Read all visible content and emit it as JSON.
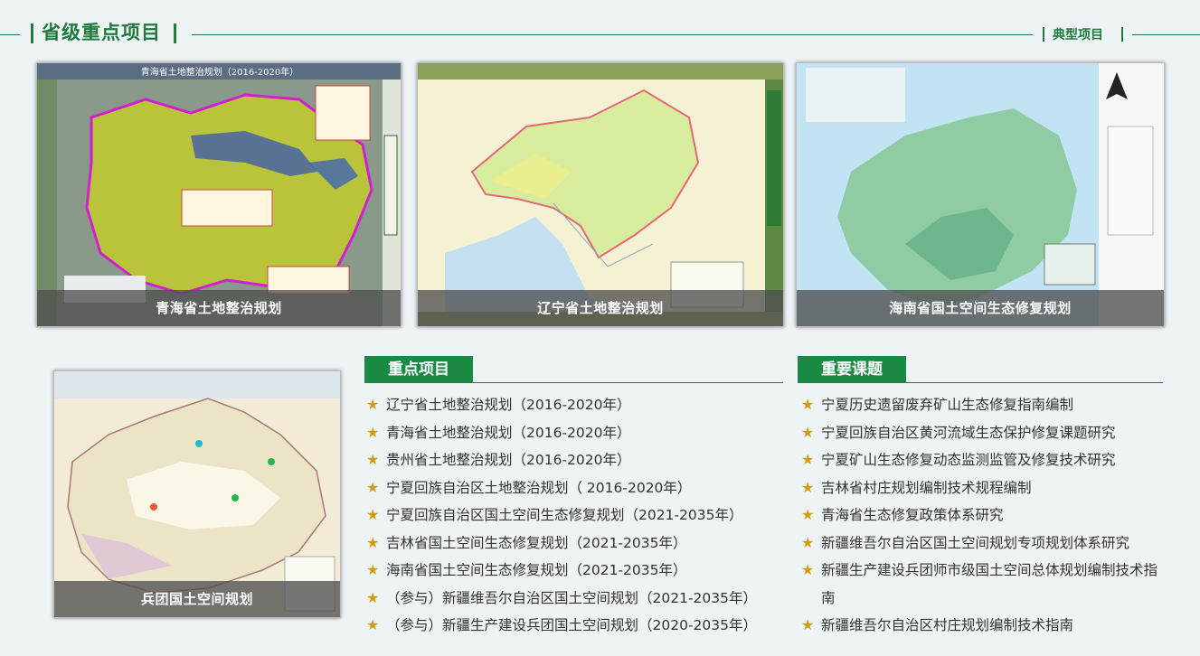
{
  "header": {
    "title": "省级重点项目",
    "more_label": "典型项目"
  },
  "cards": [
    {
      "caption": "青海省土地整治规划"
    },
    {
      "caption": "辽宁省土地整治规划"
    },
    {
      "caption": "海南省国土空间生态修复规划"
    },
    {
      "caption": "兵团国土空间规划"
    }
  ],
  "key_projects": {
    "title": "重点项目",
    "items": [
      "辽宁省土地整治规划（2016-2020年）",
      "青海省土地整治规划（2016-2020年）",
      "贵州省土地整治规划（2016-2020年）",
      "宁夏回族自治区土地整治规划（ 2016-2020年）",
      "宁夏回族自治区国土空间生态修复规划（2021-2035年）",
      "吉林省国土空间生态修复规划（2021-2035年）",
      "海南省国土空间生态修复规划（2021-2035年）",
      "（参与）新疆维吾尔自治区国土空间规划（2021-2035年）",
      "（参与）新疆生产建设兵团国土空间规划（2020-2035年）"
    ]
  },
  "key_topics": {
    "title": "重要课题",
    "items": [
      "宁夏历史遗留废弃矿山生态修复指南编制",
      "宁夏回族自治区黄河流域生态保护修复课题研究",
      "宁夏矿山生态修复动态监测监管及修复技术研究",
      "吉林省村庄规划编制技术规程编制",
      "青海省生态修复政策体系研究",
      "新疆维吾尔自治区国土空间规划专项规划体系研究",
      "新疆生产建设兵团师市级国土空间总体规划编制技术指南",
      "新疆维吾尔自治区村庄规划编制技术指南"
    ]
  },
  "colors": {
    "brand_green": "#1f7a3e",
    "tab_green": "#1b8a45",
    "star_gold": "#d39b12"
  },
  "icons": {
    "bullet": "star-icon"
  }
}
